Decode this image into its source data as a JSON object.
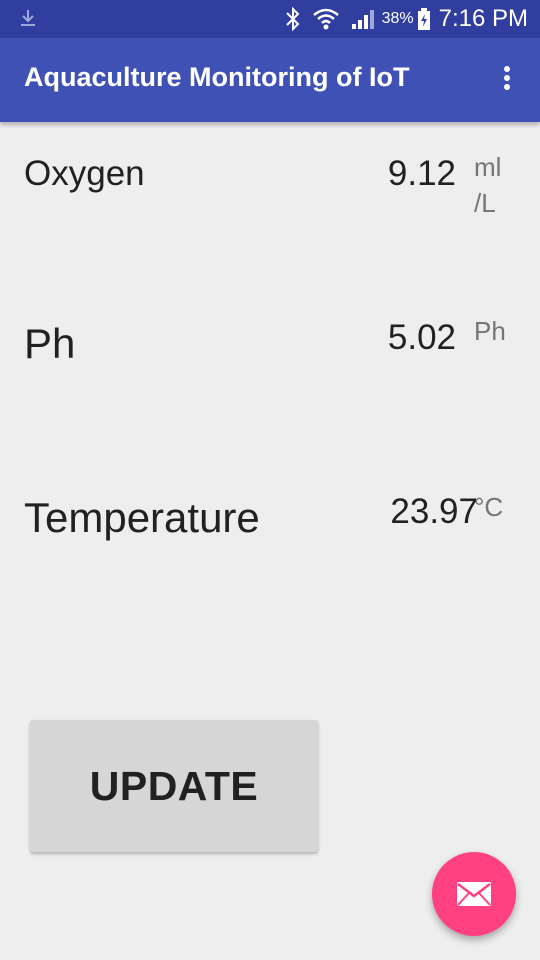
{
  "status_bar": {
    "battery_percent": "38%",
    "time": "7:16 PM",
    "icons": [
      "download-icon",
      "bluetooth-icon",
      "wifi-icon",
      "signal-icon",
      "battery-charging-icon"
    ]
  },
  "app_bar": {
    "title": "Aquaculture Monitoring of IoT",
    "menu_icon": "more-vert-icon",
    "color": "#3f51b5"
  },
  "readings": [
    {
      "label": "Oxygen",
      "value": "9.12",
      "unit_line1": "ml",
      "unit_line2": "/L"
    },
    {
      "label": "Ph",
      "value": "5.02",
      "unit_line1": "Ph"
    },
    {
      "label": "Temperature",
      "value": "23.97",
      "unit_line1": "°C"
    }
  ],
  "update_button": {
    "label": "UPDATE"
  },
  "fab": {
    "icon": "mail-icon",
    "color": "#ff4081"
  }
}
